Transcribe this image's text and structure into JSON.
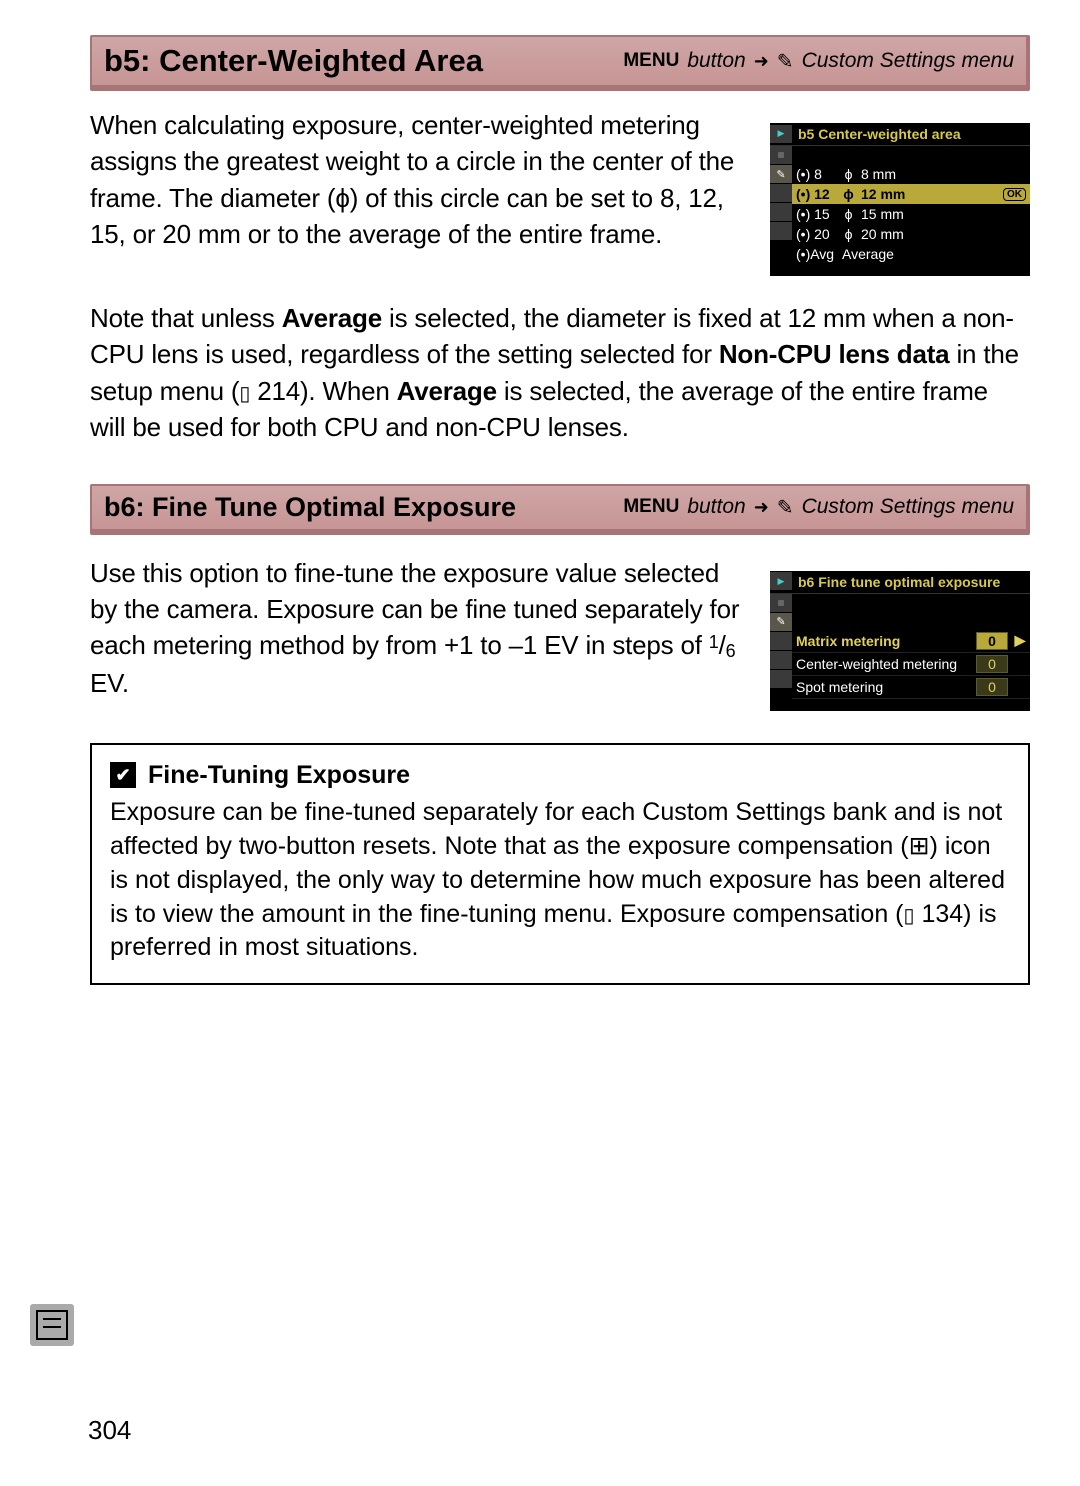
{
  "sections": {
    "b5": {
      "title": "b5: Center-Weighted Area",
      "trail_menu": "MENU",
      "trail_button": "button",
      "trail_arrow": "➜",
      "trail_csm": "Custom Settings menu",
      "para1_a": "When calculating exposure, center-weighted metering assigns the greatest weight to a circle in the center of the frame.  The diameter (",
      "para1_phi": "ϕ",
      "para1_b": ") of this circle can be set to 8, 12, 15, or 20 mm or to the average of the entire frame.",
      "para2_a": "Note that unless ",
      "para2_avg": "Average",
      "para2_b": " is selected, the diameter is fixed at 12 mm when a non-CPU lens is used, regardless of the setting selected for ",
      "para2_noncpu": "Non-CPU lens data",
      "para2_c": " in the setup menu (",
      "para2_ref": " 214). When ",
      "para2_avg2": "Average",
      "para2_d": " is selected, the average of the entire frame will be used for both CPU and non-CPU lenses.",
      "lcd": {
        "title": "b5 Center-weighted area",
        "rows": [
          {
            "code": "(•) 8",
            "phi": "ϕ",
            "mm": "8 mm"
          },
          {
            "code": "(•) 12",
            "phi": "ϕ",
            "mm": "12 mm",
            "selected": true,
            "ok": "OK"
          },
          {
            "code": "(•) 15",
            "phi": "ϕ",
            "mm": "15 mm"
          },
          {
            "code": "(•) 20",
            "phi": "ϕ",
            "mm": "20 mm"
          },
          {
            "code": "(•)Avg",
            "phi": "",
            "mm": "Average"
          }
        ]
      }
    },
    "b6": {
      "title": "b6: Fine Tune Optimal Exposure",
      "trail_menu": "MENU",
      "trail_button": "button",
      "trail_arrow": "➜",
      "trail_csm": "Custom Settings menu",
      "para_a": "Use this option to fine-tune the exposure value selected by the camera.  Exposure can be fine tuned separately for each metering method by from +1 to –1 EV in steps of ",
      "para_frac_num": "1",
      "para_frac_den": "6",
      "para_b": " EV.",
      "lcd": {
        "title": "b6 Fine tune optimal exposure",
        "rows": [
          {
            "label": "Matrix metering",
            "val": "0",
            "sel": true,
            "chev": "▶"
          },
          {
            "label": "Center-weighted metering",
            "val": "0"
          },
          {
            "label": "Spot metering",
            "val": "0"
          }
        ]
      }
    },
    "infobox": {
      "title": "Fine-Tuning Exposure",
      "text_a": "Exposure can be fine-tuned separately for each Custom Settings bank and is not affected by two-button resets.  Note that as the exposure compensation (",
      "text_b": ") icon is not displayed, the only way to determine how much exposure has been altered is to view the amount in the fine-tuning menu.  Exposure compensation (",
      "text_ref": " 134) is preferred in most situations."
    }
  },
  "page_number": "304"
}
